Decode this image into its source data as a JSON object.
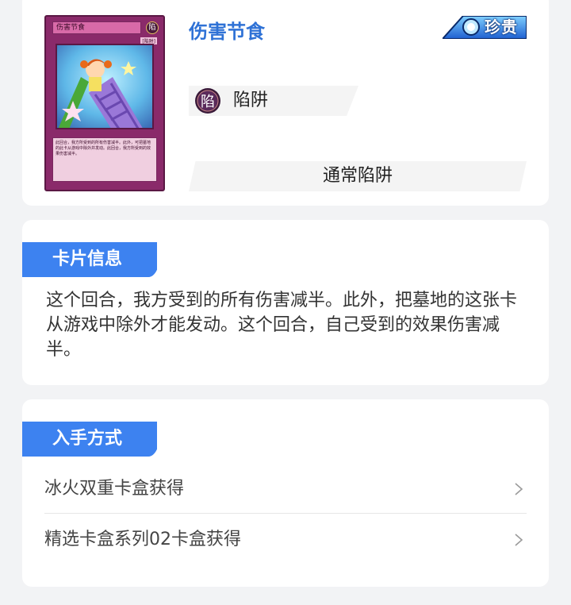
{
  "card": {
    "name": "伤害节食",
    "rarity": "珍贵",
    "type": "陷阱",
    "type_icon_char": "陷",
    "subtype": "通常陷阱",
    "art": {
      "name": "伤害节食",
      "type_tag": "[陷阱]",
      "desc": "此回合，我方所受到的所有伤害减半。此外，可把墓地的此卡从游戏中除外并发动。此回合，我方所受到的效果伤害减半。"
    }
  },
  "info_section": {
    "title": "卡片信息",
    "text": "这个回合，我方受到的所有伤害减半。此外，把墓地的这张卡从游戏中除外才能发动。这个回合，自己受到的效果伤害减半。"
  },
  "source_section": {
    "title": "入手方式",
    "items": [
      {
        "label": "冰火双重卡盒获得"
      },
      {
        "label": "精选卡盒系列02卡盒获得"
      }
    ]
  },
  "colors": {
    "accent": "#3d82f0",
    "name_blue": "#2f72d6",
    "trap_pink": "#8a2a6a"
  },
  "icons": [
    "chevron-right-icon",
    "trap-attribute-icon",
    "rarity-badge-icon"
  ]
}
